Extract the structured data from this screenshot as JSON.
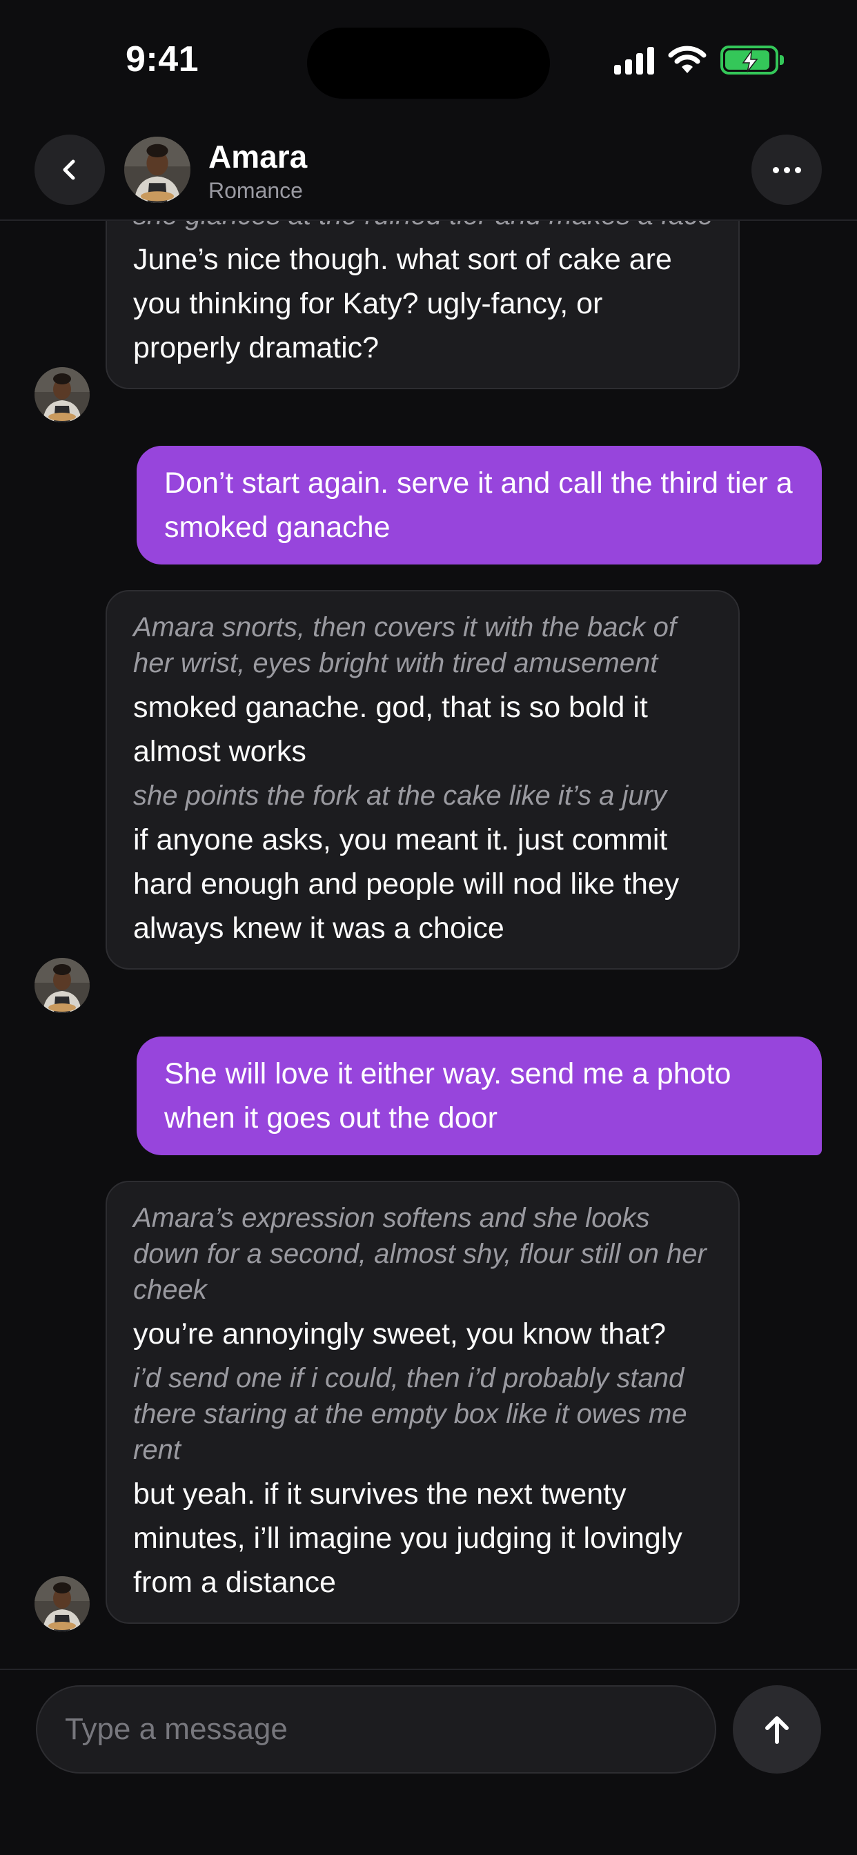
{
  "status_bar": {
    "time": "9:41",
    "icons": [
      "signal-icon",
      "wifi-icon",
      "battery-charging-icon"
    ],
    "battery_level": 0.92
  },
  "header": {
    "back_icon": "chevron-left-icon",
    "name": "Amara",
    "subtitle": "Romance",
    "more_icon": "ellipsis-icon"
  },
  "messages": [
    {
      "sender": "ai",
      "parts": [
        {
          "kind": "action",
          "text": "she glances at the ruined tier and makes a face"
        },
        {
          "kind": "line",
          "text": "June’s nice though. what sort of cake are you thinking for Katy? ugly-fancy, or properly dramatic?"
        }
      ]
    },
    {
      "sender": "user",
      "parts": [
        {
          "kind": "line",
          "text": "Don’t start again. serve it and call the third tier a smoked ganache"
        }
      ]
    },
    {
      "sender": "ai",
      "parts": [
        {
          "kind": "action",
          "text": "Amara snorts, then covers it with the back of her wrist, eyes bright with tired amusement"
        },
        {
          "kind": "line",
          "text": "smoked ganache. god, that is so bold it almost works"
        },
        {
          "kind": "action",
          "text": "she points the fork at the cake like it’s a jury"
        },
        {
          "kind": "line",
          "text": "if anyone asks, you meant it. just commit hard enough and people will nod like they always knew it was a choice"
        }
      ]
    },
    {
      "sender": "user",
      "parts": [
        {
          "kind": "line",
          "text": "She will love it either way. send me a photo when it goes out the door"
        }
      ]
    },
    {
      "sender": "ai",
      "parts": [
        {
          "kind": "action",
          "text": "Amara’s expression softens and she looks down for a second, almost shy, flour still on her cheek"
        },
        {
          "kind": "line",
          "text": "you’re annoyingly sweet, you know that?"
        },
        {
          "kind": "action",
          "text": "i’d send one if i could, then i’d probably stand there staring at the empty box like it owes me rent"
        },
        {
          "kind": "line",
          "text": "but yeah. if it survives the next twenty minutes, i’ll imagine you judging it lovingly from a distance"
        }
      ]
    }
  ],
  "composer": {
    "placeholder": "Type a message",
    "value": "",
    "send_icon": "arrow-up-icon"
  },
  "colors": {
    "background": "#0d0d0f",
    "ai_bubble": "#1c1c1f",
    "user_bubble": "#9745dc",
    "action_text": "#9a9aa0",
    "battery": "#34c759"
  }
}
